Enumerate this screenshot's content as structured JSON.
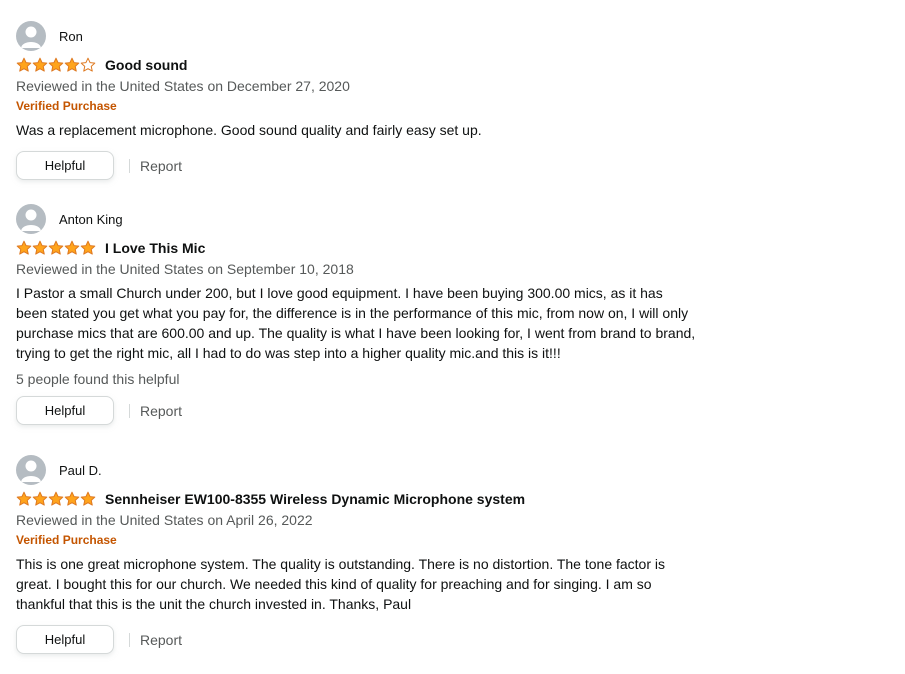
{
  "reviews": [
    {
      "profile_name": "Ron",
      "rating": 4,
      "rating_max": 5,
      "title": "Good sound",
      "date": "Reviewed in the United States on December 27, 2020",
      "verified": "Verified Purchase",
      "body": "Was a replacement microphone. Good sound quality and fairly easy set up.",
      "helpful_count": "",
      "helpful_label": "Helpful",
      "report_label": "Report"
    },
    {
      "profile_name": "Anton King",
      "rating": 5,
      "rating_max": 5,
      "title": "I Love This Mic",
      "date": "Reviewed in the United States on September 10, 2018",
      "verified": "",
      "body": "I Pastor a small Church under 200, but I love good equipment. I have been buying 300.00 mics, as it has been stated you get what you pay for, the difference is in the performance of this mic, from now on, I will only purchase mics that are 600.00 and up. The quality is what I have been looking for, I went from brand to brand, trying to get the right mic, all I had to do was step into a higher quality mic.and this is it!!!",
      "helpful_count": "5 people found this helpful",
      "helpful_label": "Helpful",
      "report_label": "Report"
    },
    {
      "profile_name": "Paul D.",
      "rating": 5,
      "rating_max": 5,
      "title": "Sennheiser EW100-8355 Wireless Dynamic Microphone system",
      "date": "Reviewed in the United States on April 26, 2022",
      "verified": "Verified Purchase",
      "body": "This is one great microphone system. The quality is outstanding. There is no distortion. The tone factor is great. I bought this for our church. We needed this kind of quality for preaching and for singing. I am so thankful that this is the unit the church invested in. Thanks, Paul",
      "helpful_count": "",
      "helpful_label": "Helpful",
      "report_label": "Report"
    }
  ],
  "colors": {
    "star_fill": "#ffa41c",
    "star_outline": "#de7921",
    "verified": "#c45500",
    "muted_text": "#565959"
  },
  "icons": {
    "avatar": "default-profile-avatar-icon",
    "star_full": "star-full-icon",
    "star_empty": "star-empty-icon"
  }
}
